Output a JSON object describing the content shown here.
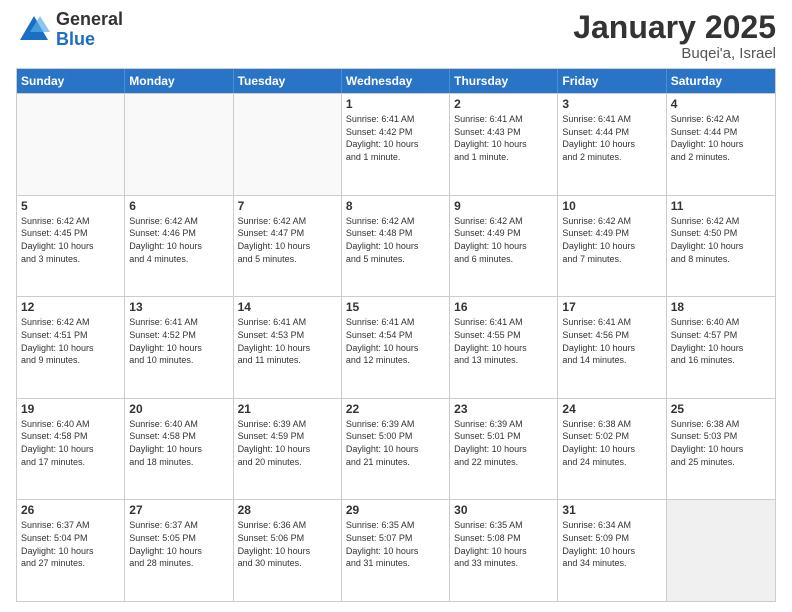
{
  "logo": {
    "general": "General",
    "blue": "Blue"
  },
  "header": {
    "month": "January 2025",
    "location": "Buqei'a, Israel"
  },
  "days": [
    "Sunday",
    "Monday",
    "Tuesday",
    "Wednesday",
    "Thursday",
    "Friday",
    "Saturday"
  ],
  "weeks": [
    [
      {
        "day": "",
        "info": ""
      },
      {
        "day": "",
        "info": ""
      },
      {
        "day": "",
        "info": ""
      },
      {
        "day": "1",
        "info": "Sunrise: 6:41 AM\nSunset: 4:42 PM\nDaylight: 10 hours\nand 1 minute."
      },
      {
        "day": "2",
        "info": "Sunrise: 6:41 AM\nSunset: 4:43 PM\nDaylight: 10 hours\nand 1 minute."
      },
      {
        "day": "3",
        "info": "Sunrise: 6:41 AM\nSunset: 4:44 PM\nDaylight: 10 hours\nand 2 minutes."
      },
      {
        "day": "4",
        "info": "Sunrise: 6:42 AM\nSunset: 4:44 PM\nDaylight: 10 hours\nand 2 minutes."
      }
    ],
    [
      {
        "day": "5",
        "info": "Sunrise: 6:42 AM\nSunset: 4:45 PM\nDaylight: 10 hours\nand 3 minutes."
      },
      {
        "day": "6",
        "info": "Sunrise: 6:42 AM\nSunset: 4:46 PM\nDaylight: 10 hours\nand 4 minutes."
      },
      {
        "day": "7",
        "info": "Sunrise: 6:42 AM\nSunset: 4:47 PM\nDaylight: 10 hours\nand 5 minutes."
      },
      {
        "day": "8",
        "info": "Sunrise: 6:42 AM\nSunset: 4:48 PM\nDaylight: 10 hours\nand 5 minutes."
      },
      {
        "day": "9",
        "info": "Sunrise: 6:42 AM\nSunset: 4:49 PM\nDaylight: 10 hours\nand 6 minutes."
      },
      {
        "day": "10",
        "info": "Sunrise: 6:42 AM\nSunset: 4:49 PM\nDaylight: 10 hours\nand 7 minutes."
      },
      {
        "day": "11",
        "info": "Sunrise: 6:42 AM\nSunset: 4:50 PM\nDaylight: 10 hours\nand 8 minutes."
      }
    ],
    [
      {
        "day": "12",
        "info": "Sunrise: 6:42 AM\nSunset: 4:51 PM\nDaylight: 10 hours\nand 9 minutes."
      },
      {
        "day": "13",
        "info": "Sunrise: 6:41 AM\nSunset: 4:52 PM\nDaylight: 10 hours\nand 10 minutes."
      },
      {
        "day": "14",
        "info": "Sunrise: 6:41 AM\nSunset: 4:53 PM\nDaylight: 10 hours\nand 11 minutes."
      },
      {
        "day": "15",
        "info": "Sunrise: 6:41 AM\nSunset: 4:54 PM\nDaylight: 10 hours\nand 12 minutes."
      },
      {
        "day": "16",
        "info": "Sunrise: 6:41 AM\nSunset: 4:55 PM\nDaylight: 10 hours\nand 13 minutes."
      },
      {
        "day": "17",
        "info": "Sunrise: 6:41 AM\nSunset: 4:56 PM\nDaylight: 10 hours\nand 14 minutes."
      },
      {
        "day": "18",
        "info": "Sunrise: 6:40 AM\nSunset: 4:57 PM\nDaylight: 10 hours\nand 16 minutes."
      }
    ],
    [
      {
        "day": "19",
        "info": "Sunrise: 6:40 AM\nSunset: 4:58 PM\nDaylight: 10 hours\nand 17 minutes."
      },
      {
        "day": "20",
        "info": "Sunrise: 6:40 AM\nSunset: 4:58 PM\nDaylight: 10 hours\nand 18 minutes."
      },
      {
        "day": "21",
        "info": "Sunrise: 6:39 AM\nSunset: 4:59 PM\nDaylight: 10 hours\nand 20 minutes."
      },
      {
        "day": "22",
        "info": "Sunrise: 6:39 AM\nSunset: 5:00 PM\nDaylight: 10 hours\nand 21 minutes."
      },
      {
        "day": "23",
        "info": "Sunrise: 6:39 AM\nSunset: 5:01 PM\nDaylight: 10 hours\nand 22 minutes."
      },
      {
        "day": "24",
        "info": "Sunrise: 6:38 AM\nSunset: 5:02 PM\nDaylight: 10 hours\nand 24 minutes."
      },
      {
        "day": "25",
        "info": "Sunrise: 6:38 AM\nSunset: 5:03 PM\nDaylight: 10 hours\nand 25 minutes."
      }
    ],
    [
      {
        "day": "26",
        "info": "Sunrise: 6:37 AM\nSunset: 5:04 PM\nDaylight: 10 hours\nand 27 minutes."
      },
      {
        "day": "27",
        "info": "Sunrise: 6:37 AM\nSunset: 5:05 PM\nDaylight: 10 hours\nand 28 minutes."
      },
      {
        "day": "28",
        "info": "Sunrise: 6:36 AM\nSunset: 5:06 PM\nDaylight: 10 hours\nand 30 minutes."
      },
      {
        "day": "29",
        "info": "Sunrise: 6:35 AM\nSunset: 5:07 PM\nDaylight: 10 hours\nand 31 minutes."
      },
      {
        "day": "30",
        "info": "Sunrise: 6:35 AM\nSunset: 5:08 PM\nDaylight: 10 hours\nand 33 minutes."
      },
      {
        "day": "31",
        "info": "Sunrise: 6:34 AM\nSunset: 5:09 PM\nDaylight: 10 hours\nand 34 minutes."
      },
      {
        "day": "",
        "info": ""
      }
    ]
  ]
}
